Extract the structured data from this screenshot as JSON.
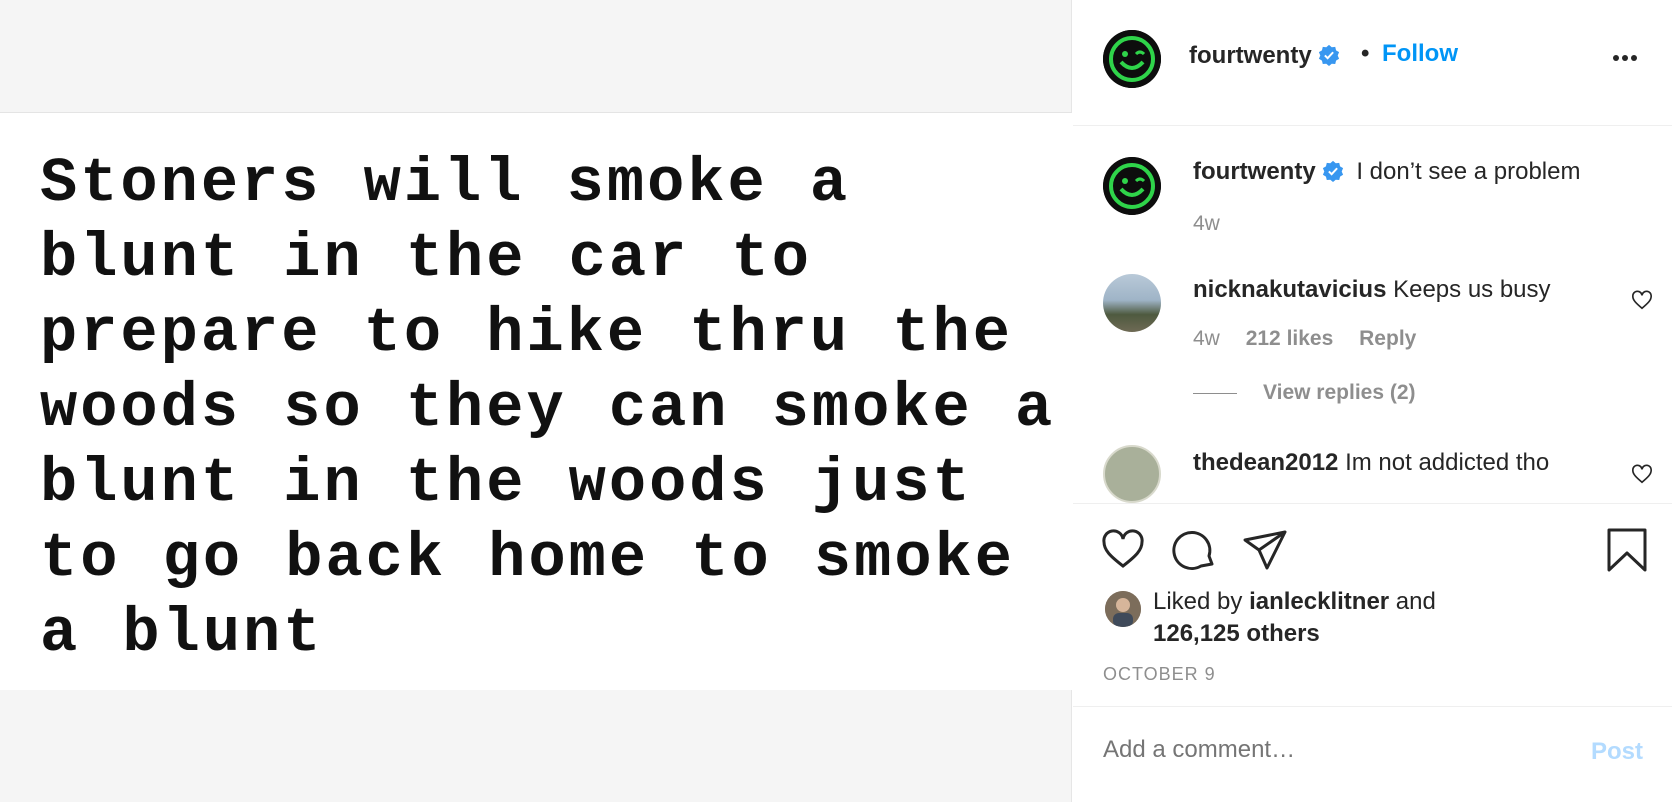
{
  "post": {
    "image_text": "Stoners will smoke a\nblunt in the car to\nprepare to hike thru the\nwoods so they can smoke a\nblunt in the woods just\nto go back home to smoke\na blunt"
  },
  "header": {
    "username": "fourtwenty",
    "separator": "•",
    "follow_label": "Follow"
  },
  "comments": [
    {
      "username": "fourtwenty",
      "text": "I don’t see a problem",
      "time": "4w"
    },
    {
      "username": "nicknakutavicius",
      "text": "Keeps us busy",
      "time": "4w",
      "likes": "212 likes",
      "reply_label": "Reply",
      "view_replies": "View replies (2)"
    },
    {
      "username": "thedean2012",
      "text": "Im not addicted tho"
    }
  ],
  "likes": {
    "prefix": "Liked by",
    "user": "ianlecklitner",
    "middle": "and",
    "others": "126,125 others"
  },
  "date": "OCTOBER 9",
  "comment_box": {
    "placeholder": "Add a comment…",
    "post_label": "Post"
  },
  "colors": {
    "accent": "#0095f6",
    "brand_green": "#2fd44a",
    "post_disabled": "#b3dbff"
  },
  "icons": [
    "more-options-icon",
    "verified-badge-icon",
    "heart-icon",
    "comment-icon",
    "share-icon",
    "bookmark-icon"
  ]
}
